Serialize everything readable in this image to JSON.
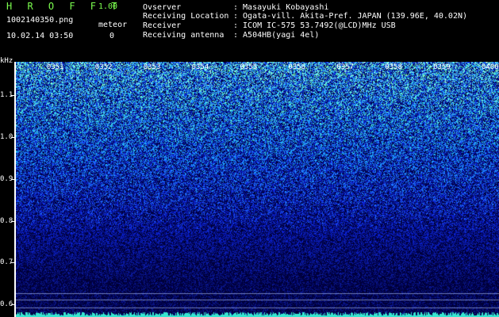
{
  "header": {
    "app_title": "H R O F F T",
    "app_version": "1.00",
    "file_name": "1002140350.png",
    "meteor_label": "meteor",
    "datetime": "10.02.14 03:50",
    "meteor_count": "0",
    "observer_label": "Ovserver",
    "observer_value": ": Masayuki Kobayashi",
    "location_label": "Receiving Location",
    "location_value": ": Ogata-vill. Akita-Pref. JAPAN (139.96E, 40.02N)",
    "receiver_label": "Receiver",
    "receiver_value": ": ICOM IC-575 53.7492(@LCD)MHz USB",
    "antenna_label": "Receiving antenna",
    "antenna_value": ": A504HB(yagi 4el)"
  },
  "spectrogram": {
    "unit_label": "kHz",
    "y_ticks": [
      "1.1",
      "1.0",
      "0.9",
      "0.8",
      "0.7",
      "0.6"
    ],
    "time_labels": [
      "0351",
      "0352",
      "0353",
      "0354",
      "0355",
      "0356",
      "0357",
      "0358",
      "0359",
      "0400"
    ],
    "palette": {
      "low": "#000033",
      "mid": "#0a1f9e",
      "high": "#3aa6ff",
      "peak": "#37e6d0"
    },
    "y_range_khz": [
      0.57,
      1.18
    ]
  }
}
